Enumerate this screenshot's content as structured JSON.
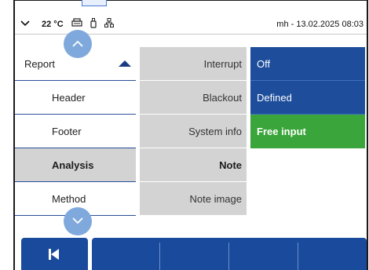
{
  "status_bar": {
    "chevron_icon": "chevron-down-icon",
    "temperature": "22 °C",
    "icons": [
      "printer-icon",
      "usb-stick-icon",
      "network-icon"
    ],
    "user_datetime": "mh - 13.02.2025 08:03"
  },
  "nav": {
    "scroll_up_icon": "chevron-up-icon",
    "scroll_down_icon": "chevron-down-icon"
  },
  "menu_col1": {
    "parent": "Report",
    "items": [
      {
        "label": "Header",
        "selected": false
      },
      {
        "label": "Footer",
        "selected": false
      },
      {
        "label": "Analysis",
        "selected": true
      },
      {
        "label": "Method",
        "selected": false
      }
    ]
  },
  "menu_col2": {
    "items": [
      {
        "label": "Interrupt",
        "selected": false
      },
      {
        "label": "Blackout",
        "selected": false
      },
      {
        "label": "System info",
        "selected": false
      },
      {
        "label": "Note",
        "selected": true
      },
      {
        "label": "Note image",
        "selected": false
      }
    ]
  },
  "menu_col3": {
    "items": [
      {
        "label": "Off",
        "selected": false
      },
      {
        "label": "Defined",
        "selected": false
      },
      {
        "label": "Free input",
        "selected": true
      }
    ],
    "selected_color": "#3aa53a",
    "option_color": "#1d4d9b"
  },
  "bottom_bar": {
    "back_icon": "skip-back-icon",
    "function_slots": 4
  },
  "colors": {
    "accent": "#1a4a9b",
    "nav_circle": "#7fa9dc",
    "selection_gray": "#d3d3d3"
  }
}
